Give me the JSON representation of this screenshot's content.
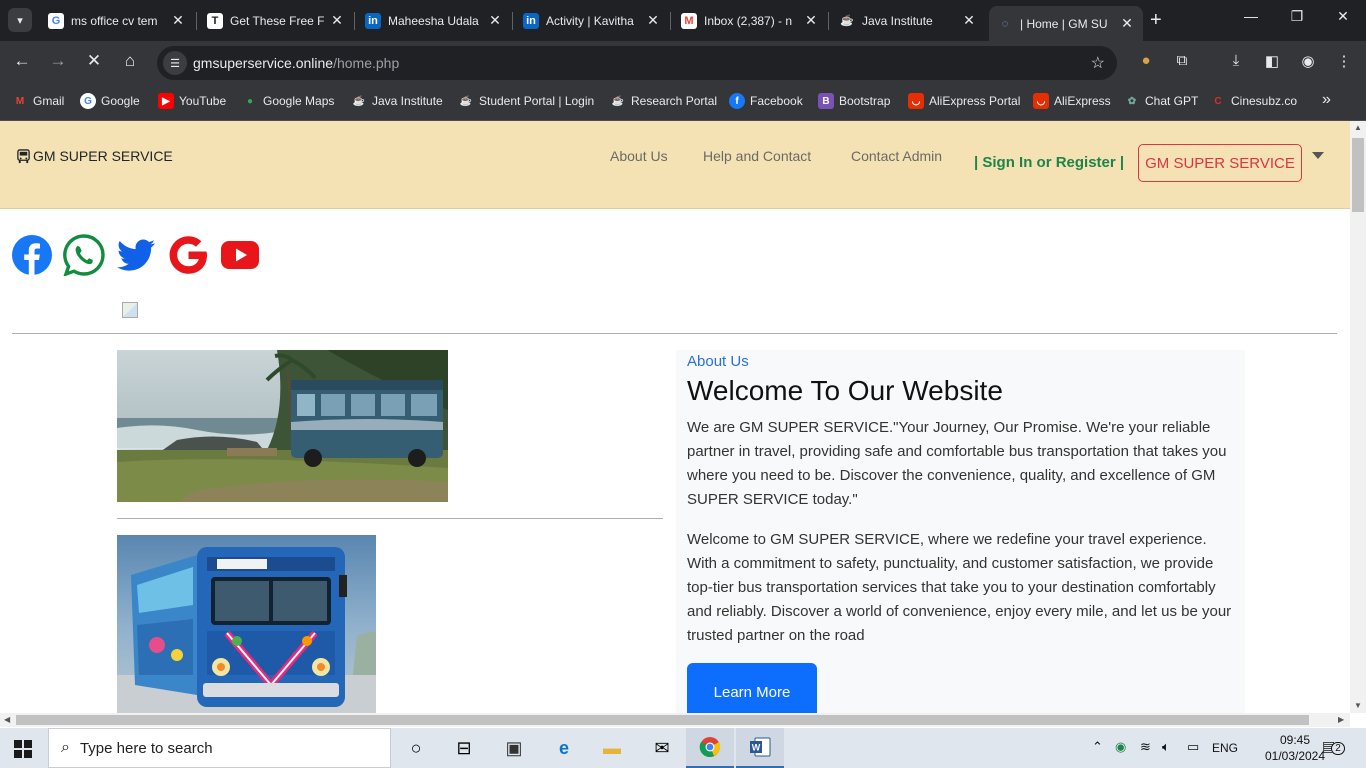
{
  "browser": {
    "tabs": [
      {
        "title": "ms office cv tem",
        "icon": "google-icon"
      },
      {
        "title": "Get These Free F",
        "icon": "document-icon"
      },
      {
        "title": "Maheesha Udala",
        "icon": "linkedin-icon"
      },
      {
        "title": "Activity | Kavitha",
        "icon": "linkedin-icon"
      },
      {
        "title": "Inbox (2,387) - n",
        "icon": "gmail-icon"
      },
      {
        "title": "Java Institute",
        "icon": "java-icon"
      },
      {
        "title": "| Home | GM SU",
        "icon": "loading-icon",
        "active": true
      }
    ],
    "url_host": "gmsuperservice.online",
    "url_path": "/home.php",
    "bookmarks": [
      {
        "label": "Gmail",
        "icon": "gmail-icon"
      },
      {
        "label": "Google",
        "icon": "google-icon"
      },
      {
        "label": "YouTube",
        "icon": "youtube-icon"
      },
      {
        "label": "Google Maps",
        "icon": "maps-pin-icon"
      },
      {
        "label": "Java Institute",
        "icon": "java-icon"
      },
      {
        "label": "Student Portal | Login",
        "icon": "java-icon"
      },
      {
        "label": "Research Portal",
        "icon": "java-icon"
      },
      {
        "label": "Facebook",
        "icon": "facebook-icon"
      },
      {
        "label": "Bootstrap",
        "icon": "bootstrap-icon"
      },
      {
        "label": "AliExpress Portal",
        "icon": "aliexpress-icon"
      },
      {
        "label": "AliExpress",
        "icon": "aliexpress-icon"
      },
      {
        "label": "Chat GPT",
        "icon": "chatgpt-icon"
      },
      {
        "label": "Cinesubz.co",
        "icon": "cinesubz-icon"
      }
    ]
  },
  "site": {
    "brand": "GM SUPER SERVICE",
    "nav": {
      "about": "About Us",
      "help": "Help and Contact",
      "contact_admin": "Contact Admin",
      "signin": "| Sign In or Register |",
      "brand_button": "GM SUPER SERVICE"
    },
    "social": [
      "facebook-icon",
      "whatsapp-icon",
      "twitter-icon",
      "google-icon",
      "youtube-icon"
    ],
    "about": {
      "label": "About Us",
      "heading": "Welcome To Our Website",
      "para1": "We are GM SUPER SERVICE.\"Your Journey, Our Promise. We're your reliable partner in travel, providing safe and comfortable bus transportation that takes you where you need to be. Discover the convenience, quality, and excellence of GM SUPER SERVICE today.\"",
      "para2": "Welcome to GM SUPER SERVICE, where we redefine your travel experience. With a commitment to safety, punctuality, and customer satisfaction, we provide top-tier bus transportation services that take you to your destination comfortably and reliably. Discover a world of convenience, enjoy every mile, and let us be your trusted partner on the road",
      "button": "Learn More"
    },
    "colors": {
      "navbar_bg": "#f4e2b5",
      "signin": "#1e8449",
      "brand_button": "#dc3545",
      "primary": "#0d6efd",
      "about_label": "#2a6fdb"
    }
  },
  "taskbar": {
    "search_placeholder": "Type here to search",
    "language": "ENG",
    "time": "09:45",
    "date": "01/03/2024",
    "notifications": "2"
  }
}
